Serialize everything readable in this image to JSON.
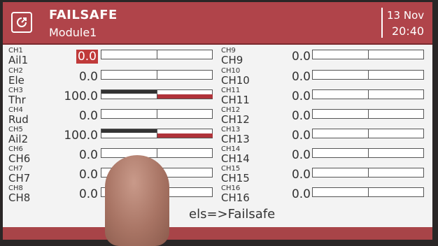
{
  "header": {
    "title": "FAILSAFE",
    "subtitle": "Module1",
    "date": "13 Nov",
    "time": "20:40"
  },
  "left_channels": [
    {
      "ch": "CH1",
      "name": "Ail1",
      "value": "0.0",
      "selected": true,
      "neg": 0,
      "pos": 0
    },
    {
      "ch": "CH2",
      "name": "Ele",
      "value": "0.0",
      "selected": false,
      "neg": 0,
      "pos": 0
    },
    {
      "ch": "CH3",
      "name": "Thr",
      "value": "100.0",
      "selected": false,
      "neg": 1,
      "pos": 1
    },
    {
      "ch": "CH4",
      "name": "Rud",
      "value": "0.0",
      "selected": false,
      "neg": 0,
      "pos": 0
    },
    {
      "ch": "CH5",
      "name": "Ail2",
      "value": "100.0",
      "selected": false,
      "neg": 1,
      "pos": 1
    },
    {
      "ch": "CH6",
      "name": "CH6",
      "value": "0.0",
      "selected": false,
      "neg": 0,
      "pos": 0
    },
    {
      "ch": "CH7",
      "name": "CH7",
      "value": "0.0",
      "selected": false,
      "neg": 0,
      "pos": 0
    },
    {
      "ch": "CH8",
      "name": "CH8",
      "value": "0.0",
      "selected": false,
      "neg": 0,
      "pos": 0
    }
  ],
  "right_channels": [
    {
      "ch": "CH9",
      "name": "CH9",
      "value": "0.0",
      "neg": 0,
      "pos": 0
    },
    {
      "ch": "CH10",
      "name": "CH10",
      "value": "0.0",
      "neg": 0,
      "pos": 0
    },
    {
      "ch": "CH11",
      "name": "CH11",
      "value": "0.0",
      "neg": 0,
      "pos": 0
    },
    {
      "ch": "CH12",
      "name": "CH12",
      "value": "0.0",
      "neg": 0,
      "pos": 0
    },
    {
      "ch": "CH13",
      "name": "CH13",
      "value": "0.0",
      "neg": 0,
      "pos": 0
    },
    {
      "ch": "CH14",
      "name": "CH14",
      "value": "0.0",
      "neg": 0,
      "pos": 0
    },
    {
      "ch": "CH15",
      "name": "CH15",
      "value": "0.0",
      "neg": 0,
      "pos": 0
    },
    {
      "ch": "CH16",
      "name": "CH16",
      "value": "0.0",
      "neg": 0,
      "pos": 0
    }
  ],
  "footer": {
    "action_label": "els=>Failsafe"
  },
  "colors": {
    "header_bg": "#b0444a",
    "selected_value_bg": "#c03a3a",
    "bar_negative": "#333333",
    "bar_positive": "#b0333a"
  },
  "icons": {
    "back": "back-arrow-icon"
  }
}
